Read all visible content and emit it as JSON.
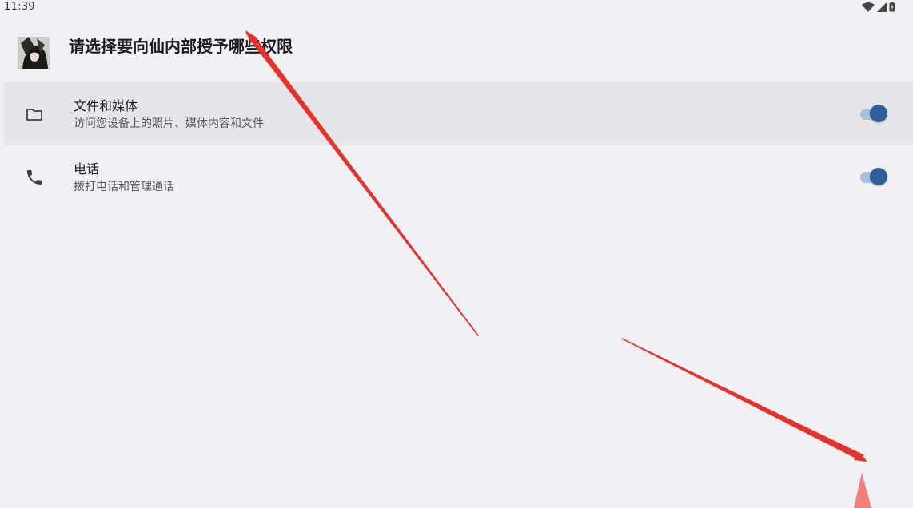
{
  "status_bar": {
    "time": "11:39",
    "icons": [
      "wifi-icon",
      "cell-signal-icon",
      "battery-icon"
    ]
  },
  "dialog": {
    "title_prefix": "请选择要向",
    "app_name": "仙内部",
    "title_suffix": "授予哪些权限"
  },
  "permissions": [
    {
      "icon": "folder-icon",
      "title": "文件和媒体",
      "description": "访问您设备上的照片、媒体内容和文件",
      "enabled": true,
      "selected": true
    },
    {
      "icon": "phone-icon",
      "title": "电话",
      "description": "拨打电话和管理通话",
      "enabled": true,
      "selected": false
    }
  ],
  "colors": {
    "background": "#f1f0f5",
    "selected_row": "#e6e5ea",
    "toggle_thumb": "#2e5f99",
    "toggle_track": "#a8bfdc",
    "annotation_arrow": "#e5322b"
  }
}
